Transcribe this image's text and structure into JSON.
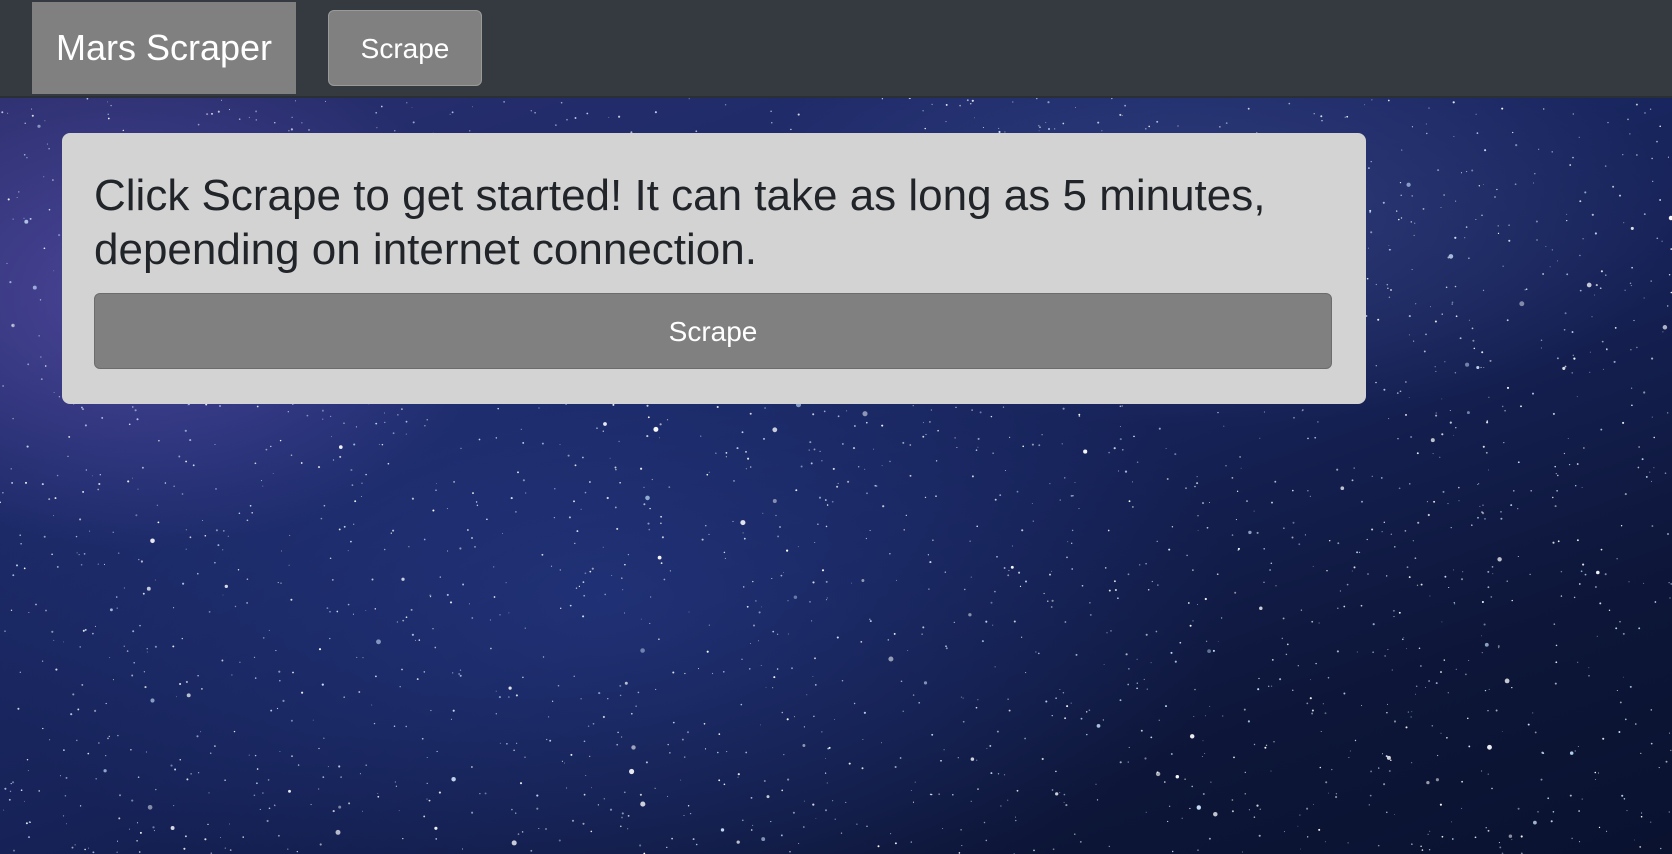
{
  "navbar": {
    "brand": "Mars Scraper",
    "scrape_label": "Scrape"
  },
  "jumbotron": {
    "message": "Click Scrape to get started! It can take as long as 5 minutes, depending on internet connection.",
    "button_label": "Scrape"
  },
  "colors": {
    "navbar_bg": "#343a40",
    "button_bg": "#808080",
    "card_bg": "#d3d3d3",
    "text": "#212529"
  }
}
